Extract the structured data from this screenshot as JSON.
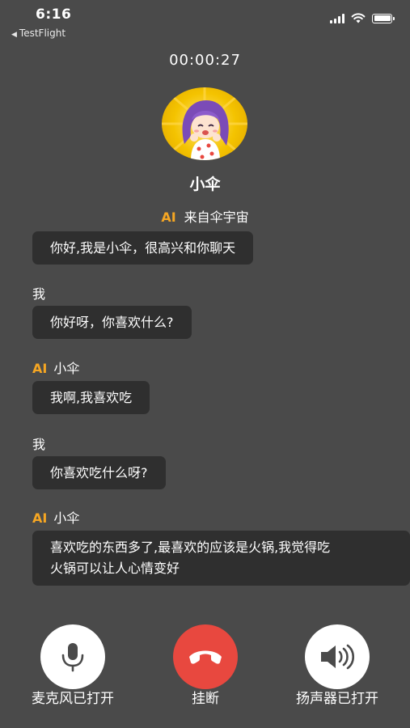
{
  "status": {
    "time": "6:16",
    "back_app": "TestFlight"
  },
  "call": {
    "timer": "00:00:27",
    "contact_name": "小伞",
    "ai_tag": "AI",
    "subtitle": "来自伞宇宙"
  },
  "messages": [
    {
      "speaker": "",
      "text": "你好,我是小伞，很高兴和你聊天"
    },
    {
      "speaker": "我",
      "text": "你好呀，你喜欢什么?"
    },
    {
      "speaker": "小伞",
      "ai": "AI",
      "text": "我啊,我喜欢吃"
    },
    {
      "speaker": "我",
      "text": "你喜欢吃什么呀?"
    },
    {
      "speaker": "小伞",
      "ai": "AI",
      "text_line1": "喜欢吃的东西多了,最喜欢的应该是火锅,我觉得吃",
      "text_line2": "火锅可以让人心情变好"
    }
  ],
  "controls": {
    "mic": {
      "label": "麦克风已打开",
      "icon": "microphone-icon"
    },
    "hangup": {
      "label": "挂断",
      "icon": "phone-hangup-icon"
    },
    "speaker": {
      "label": "扬声器已打开",
      "icon": "speaker-icon"
    }
  },
  "colors": {
    "background": "#4a4a4a",
    "bubble": "#2f2f2f",
    "ai_accent": "#f5a623",
    "hangup": "#e8483f"
  }
}
